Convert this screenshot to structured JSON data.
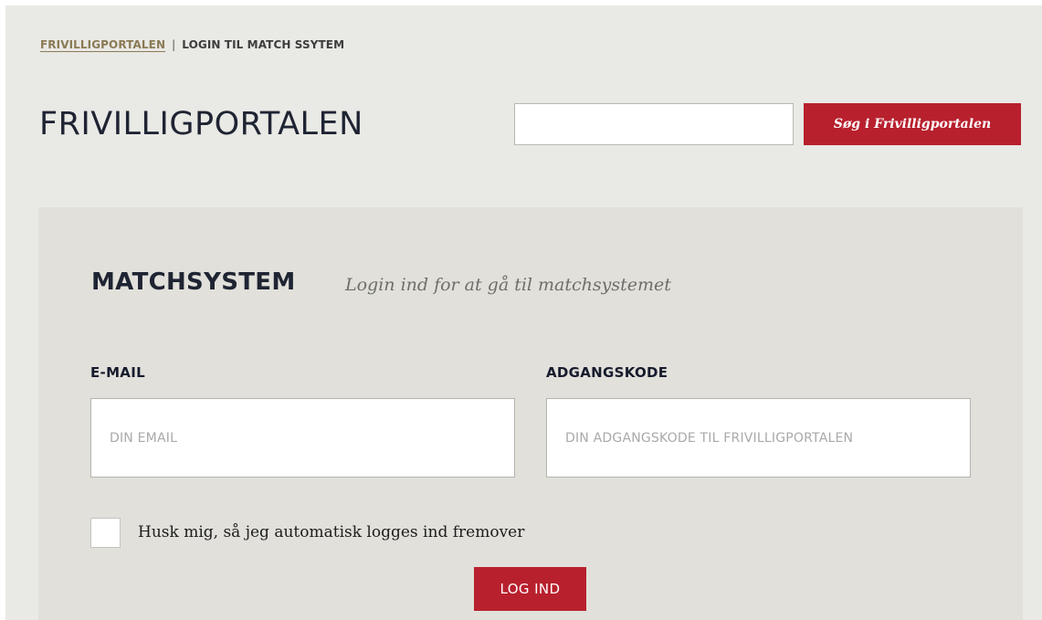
{
  "breadcrumb": {
    "home": "FRIVILLIGPORTALEN",
    "separator": "|",
    "current": "LOGIN TIL MATCH SSYTEM"
  },
  "header": {
    "title": "FRIVILLIGPORTALEN",
    "search_value": "",
    "search_button": "Søg i Frivilligportalen"
  },
  "panel": {
    "title": "MATCHSYSTEM",
    "subtitle": "Login ind for at gå til matchsystemet",
    "email_label": "E-MAIL",
    "email_placeholder": "DIN EMAIL",
    "password_label": "ADGANGSKODE",
    "password_placeholder": "DIN ADGANGSKODE TIL FRIVILLIGPORTALEN",
    "remember_label": "Husk mig, så jeg automatisk logges ind fremover",
    "remember_checked": false,
    "login_button": "LOG IND"
  },
  "colors": {
    "accent": "#b8202d",
    "page_background": "#e9e9e5",
    "panel_background": "#e1e0da",
    "link": "#8b7a55"
  }
}
